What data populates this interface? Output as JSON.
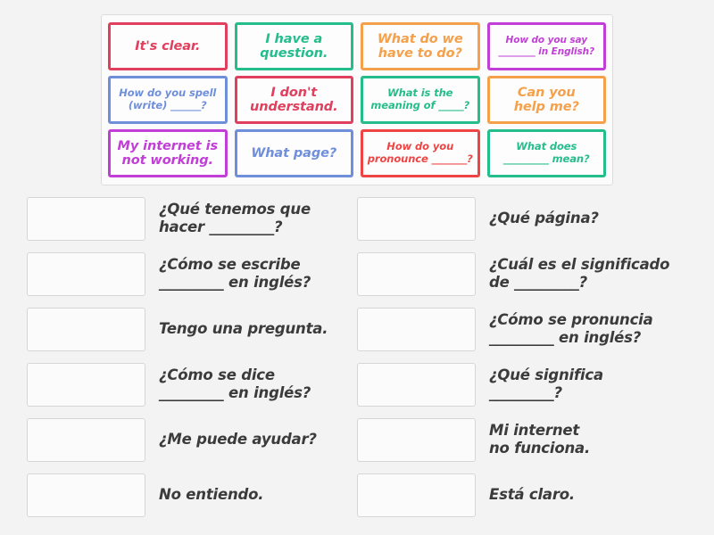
{
  "activity": {
    "type": "match-up",
    "title": "Classroom phrases English / Spanish match up"
  },
  "palette": {
    "crimson": "#e0405e",
    "green": "#25bd8b",
    "orange": "#f5a04a",
    "purple": "#c13fd6",
    "blue": "#6f8fdb",
    "red": "#ef4444",
    "background": "#f4f3f4",
    "tray_background": "#fbfbfb",
    "dropzone_border": "#d6d6d6",
    "answer_text": "#3b3b3b"
  },
  "tray": {
    "cards": [
      {
        "id": "card-its-clear",
        "lines": [
          "It's clear."
        ],
        "color": "#e0405e",
        "size": "normal"
      },
      {
        "id": "card-i-have-question",
        "lines": [
          "I have a",
          "question."
        ],
        "color": "#25bd8b",
        "size": "normal"
      },
      {
        "id": "card-what-do-we-do",
        "lines": [
          "What do we",
          "have to do?"
        ],
        "color": "#f5a04a",
        "size": "normal"
      },
      {
        "id": "card-how-do-you-say",
        "lines": [
          "How do you say",
          "________ in English?"
        ],
        "color": "#c13fd6",
        "size": "small"
      },
      {
        "id": "card-how-spell",
        "lines": [
          "How do you spell",
          "(write) ______?"
        ],
        "color": "#6f8fdb",
        "size": "mid"
      },
      {
        "id": "card-dont-understand",
        "lines": [
          "I don't",
          "understand."
        ],
        "color": "#e0405e",
        "size": "normal"
      },
      {
        "id": "card-meaning-of",
        "lines": [
          "What is the",
          "meaning of _____?"
        ],
        "color": "#25bd8b",
        "size": "mid"
      },
      {
        "id": "card-can-you-help",
        "lines": [
          "Can you",
          "help me?"
        ],
        "color": "#f5a04a",
        "size": "normal"
      },
      {
        "id": "card-internet-not-working",
        "lines": [
          "My internet is",
          "not working."
        ],
        "color": "#c13fd6",
        "size": "normal"
      },
      {
        "id": "card-what-page",
        "lines": [
          "What page?"
        ],
        "color": "#6f8fdb",
        "size": "normal"
      },
      {
        "id": "card-how-pronounce",
        "lines": [
          "How do you",
          "pronounce _______?"
        ],
        "color": "#ef4444",
        "size": "mid"
      },
      {
        "id": "card-what-does-mean",
        "lines": [
          "What does",
          "_________ mean?"
        ],
        "color": "#25bd8b",
        "size": "mid"
      }
    ]
  },
  "answers": {
    "left_column": [
      {
        "id": "answer-que-tenemos",
        "lines": [
          "¿Qué tenemos que",
          "hacer _________?"
        ]
      },
      {
        "id": "answer-como-escribe",
        "lines": [
          "¿Cómo se escribe",
          "_________ en inglés?"
        ]
      },
      {
        "id": "answer-tengo-pregunta",
        "lines": [
          "Tengo una pregunta."
        ]
      },
      {
        "id": "answer-como-dice",
        "lines": [
          "¿Cómo se dice",
          "_________ en inglés?"
        ]
      },
      {
        "id": "answer-me-puede-ayudar",
        "lines": [
          "¿Me puede ayudar?"
        ]
      },
      {
        "id": "answer-no-entiendo",
        "lines": [
          "No entiendo."
        ]
      }
    ],
    "right_column": [
      {
        "id": "answer-que-pagina",
        "lines": [
          "¿Qué página?"
        ]
      },
      {
        "id": "answer-cual-significado",
        "lines": [
          "¿Cuál es el significado",
          "de _________?"
        ]
      },
      {
        "id": "answer-como-pronuncia",
        "lines": [
          "¿Cómo se pronuncia",
          "_________ en inglés?"
        ]
      },
      {
        "id": "answer-que-significa",
        "lines": [
          "¿Qué significa",
          "_________?"
        ]
      },
      {
        "id": "answer-mi-internet",
        "lines": [
          "Mi internet",
          "no funciona."
        ]
      },
      {
        "id": "answer-esta-claro",
        "lines": [
          "Está claro."
        ]
      }
    ]
  }
}
